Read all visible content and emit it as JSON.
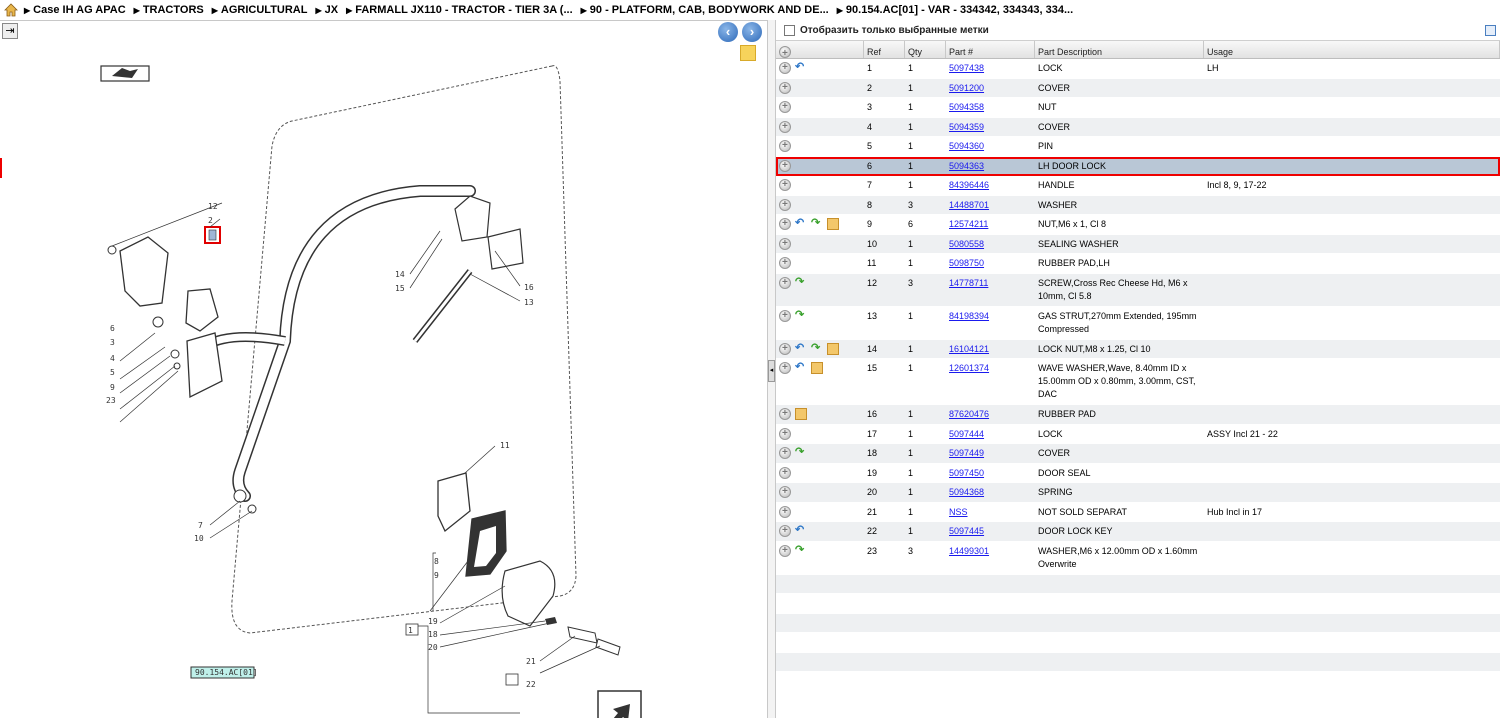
{
  "breadcrumb": [
    "Case IH AG APAC",
    "TRACTORS",
    "AGRICULTURAL",
    "JX",
    "FARMALL JX110 - TRACTOR - TIER 3A (...",
    "90 - PLATFORM, CAB, BODYWORK AND DE...",
    "90.154.AC[01] - VAR - 334342, 334343, 334..."
  ],
  "filter": {
    "label": "Отобразить только выбранные метки",
    "checked": false
  },
  "table": {
    "headers": {
      "ref": "Ref",
      "qty": "Qty",
      "part": "Part #",
      "desc": "Part Description",
      "usage": "Usage"
    },
    "rows": [
      {
        "icons": [
          "back"
        ],
        "ref": "1",
        "qty": "1",
        "part": "5097438",
        "desc": "LOCK",
        "usage": "LH"
      },
      {
        "icons": [],
        "ref": "2",
        "qty": "1",
        "part": "5091200",
        "desc": "COVER",
        "usage": ""
      },
      {
        "icons": [],
        "ref": "3",
        "qty": "1",
        "part": "5094358",
        "desc": "NUT",
        "usage": ""
      },
      {
        "icons": [],
        "ref": "4",
        "qty": "1",
        "part": "5094359",
        "desc": "COVER",
        "usage": ""
      },
      {
        "icons": [],
        "ref": "5",
        "qty": "1",
        "part": "5094360",
        "desc": "PIN",
        "usage": ""
      },
      {
        "icons": [],
        "ref": "6",
        "qty": "1",
        "part": "5094363",
        "desc": "LH DOOR LOCK",
        "usage": "",
        "selected": true
      },
      {
        "icons": [],
        "ref": "7",
        "qty": "1",
        "part": "84396446",
        "desc": "HANDLE",
        "usage": "Incl 8, 9, 17-22"
      },
      {
        "icons": [],
        "ref": "8",
        "qty": "3",
        "part": "14488701",
        "desc": "WASHER",
        "usage": ""
      },
      {
        "icons": [
          "back",
          "fwd",
          "box"
        ],
        "ref": "9",
        "qty": "6",
        "part": "12574211",
        "desc": "NUT,M6 x 1, Cl 8",
        "usage": ""
      },
      {
        "icons": [],
        "ref": "10",
        "qty": "1",
        "part": "5080558",
        "desc": "SEALING WASHER",
        "usage": ""
      },
      {
        "icons": [],
        "ref": "11",
        "qty": "1",
        "part": "5098750",
        "desc": "RUBBER PAD,LH",
        "usage": ""
      },
      {
        "icons": [
          "fwd"
        ],
        "ref": "12",
        "qty": "3",
        "part": "14778711",
        "desc": "SCREW,Cross Rec Cheese Hd, M6 x 10mm, Cl 5.8",
        "usage": ""
      },
      {
        "icons": [
          "fwd"
        ],
        "ref": "13",
        "qty": "1",
        "part": "84198394",
        "desc": "GAS STRUT,270mm Extended, 195mm Compressed",
        "usage": ""
      },
      {
        "icons": [
          "back",
          "fwd",
          "box"
        ],
        "ref": "14",
        "qty": "1",
        "part": "16104121",
        "desc": "LOCK NUT,M8 x 1.25, Cl 10",
        "usage": ""
      },
      {
        "icons": [
          "back",
          "box"
        ],
        "ref": "15",
        "qty": "1",
        "part": "12601374",
        "desc": "WAVE WASHER,Wave, 8.40mm ID x 15.00mm OD x 0.80mm, 3.00mm, CST, DAC",
        "usage": ""
      },
      {
        "icons": [
          "box"
        ],
        "ref": "16",
        "qty": "1",
        "part": "87620476",
        "desc": "RUBBER PAD",
        "usage": ""
      },
      {
        "icons": [],
        "ref": "17",
        "qty": "1",
        "part": "5097444",
        "desc": "LOCK",
        "usage": "ASSY Incl 21 - 22"
      },
      {
        "icons": [
          "fwd"
        ],
        "ref": "18",
        "qty": "1",
        "part": "5097449",
        "desc": "COVER",
        "usage": ""
      },
      {
        "icons": [],
        "ref": "19",
        "qty": "1",
        "part": "5097450",
        "desc": "DOOR SEAL",
        "usage": ""
      },
      {
        "icons": [],
        "ref": "20",
        "qty": "1",
        "part": "5094368",
        "desc": "SPRING",
        "usage": ""
      },
      {
        "icons": [],
        "ref": "21",
        "qty": "1",
        "part": "NSS",
        "desc": "NOT SOLD SEPARAT",
        "usage": "Hub Incl in 17"
      },
      {
        "icons": [
          "back"
        ],
        "ref": "22",
        "qty": "1",
        "part": "5097445",
        "desc": "DOOR LOCK KEY",
        "usage": ""
      },
      {
        "icons": [
          "fwd"
        ],
        "ref": "23",
        "qty": "3",
        "part": "14499301",
        "desc": "WASHER,M6 x 12.00mm OD x 1.60mm Overwrite",
        "usage": ""
      }
    ]
  },
  "diagram": {
    "callouts": [
      "12",
      "2",
      "14",
      "15",
      "16",
      "13",
      "3",
      "4",
      "5",
      "9",
      "23",
      "6",
      "11",
      "7",
      "10",
      "8",
      "19",
      "18",
      "20",
      "1",
      "21",
      "22"
    ],
    "label": "90.154.AC[01]"
  },
  "colors": {
    "link": "#1a1aee",
    "selected_row": "#b9c7d6",
    "highlight_border": "#e00000",
    "even_row": "#eef0f2"
  }
}
